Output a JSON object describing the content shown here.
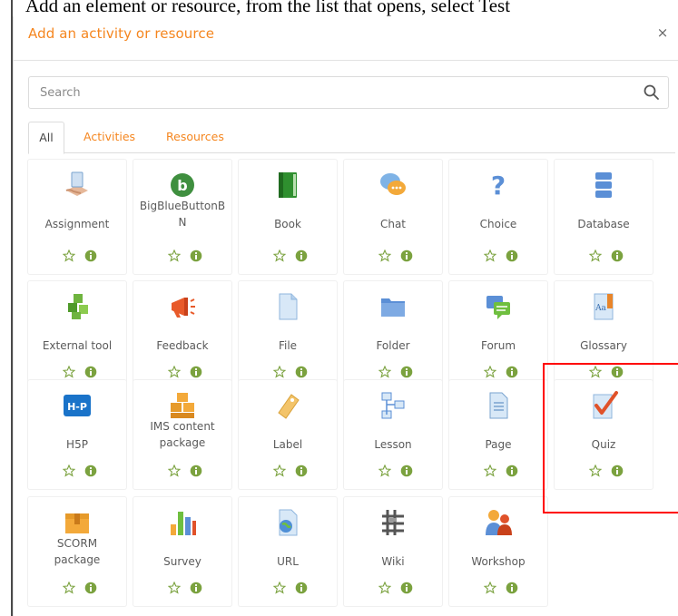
{
  "instruction_text": "Add an element or resource, from the list that opens, select Test",
  "modal": {
    "title": "Add an activity or resource",
    "close_symbol": "×"
  },
  "search": {
    "placeholder": "Search",
    "value": ""
  },
  "tabs": [
    {
      "label": "All",
      "active": true
    },
    {
      "label": "Activities",
      "active": false
    },
    {
      "label": "Resources",
      "active": false
    }
  ],
  "tiles": [
    {
      "label": "Assignment",
      "icon": "assignment-icon"
    },
    {
      "label": "BigBlueButtonB\nN",
      "icon": "bigbluebutton-icon"
    },
    {
      "label": "Book",
      "icon": "book-icon"
    },
    {
      "label": "Chat",
      "icon": "chat-icon"
    },
    {
      "label": "Choice",
      "icon": "choice-icon"
    },
    {
      "label": "Database",
      "icon": "database-icon"
    },
    {
      "label": "External tool",
      "icon": "external-tool-icon"
    },
    {
      "label": "Feedback",
      "icon": "feedback-icon"
    },
    {
      "label": "File",
      "icon": "file-icon"
    },
    {
      "label": "Folder",
      "icon": "folder-icon"
    },
    {
      "label": "Forum",
      "icon": "forum-icon"
    },
    {
      "label": "Glossary",
      "icon": "glossary-icon"
    },
    {
      "label": "H5P",
      "icon": "h5p-icon"
    },
    {
      "label": "IMS content\npackage",
      "icon": "ims-content-package-icon"
    },
    {
      "label": "Label",
      "icon": "label-icon"
    },
    {
      "label": "Lesson",
      "icon": "lesson-icon"
    },
    {
      "label": "Page",
      "icon": "page-icon"
    },
    {
      "label": "Quiz",
      "icon": "quiz-icon"
    },
    {
      "label": "SCORM\npackage",
      "icon": "scorm-package-icon"
    },
    {
      "label": "Survey",
      "icon": "survey-icon"
    },
    {
      "label": "URL",
      "icon": "url-icon"
    },
    {
      "label": "Wiki",
      "icon": "wiki-icon"
    },
    {
      "label": "Workshop",
      "icon": "workshop-icon"
    }
  ],
  "colors": {
    "accent": "#f5861f",
    "info": "#7ba23f",
    "highlight": "#ff0000"
  }
}
